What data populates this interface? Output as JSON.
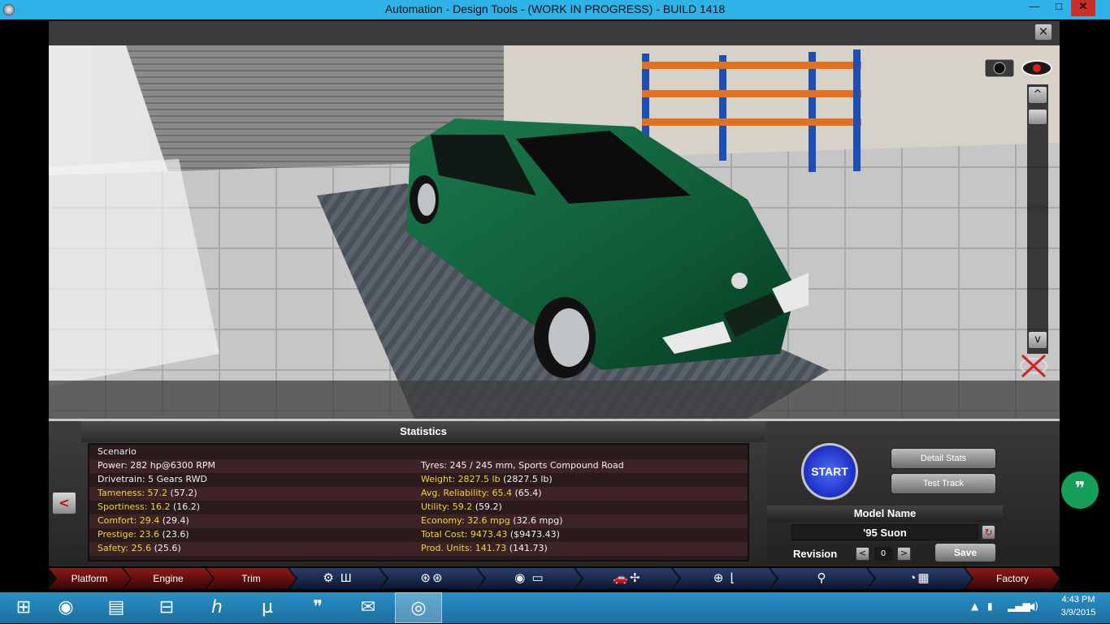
{
  "window": {
    "title": "Automation - Design Tools - (WORK IN PROGRESS) - BUILD 1418",
    "min_label": "—",
    "max_label": "□",
    "close_label": "✕"
  },
  "viewport": {
    "close_label": "✕",
    "scroll_up": "^",
    "scroll_down": "v",
    "car_color": "#0f5a37"
  },
  "statistics": {
    "header": "Statistics",
    "rows": [
      {
        "left": "Scenario",
        "right": "",
        "left_color": "white",
        "right_color": "white"
      },
      {
        "left": "Power: 282 hp@6300 RPM",
        "right": "Tyres: 245 / 245 mm, Sports Compound Road",
        "left_color": "white",
        "right_color": "white"
      },
      {
        "left": "Drivetrain: 5 Gears RWD",
        "right": "Weight: 2827.5 lb",
        "right_extra": "(2827.5 lb)",
        "left_color": "white",
        "right_color": "yellow"
      },
      {
        "left": "Tameness: 57.2",
        "left_extra": "(57.2)",
        "right": "Avg. Reliability: 65.4",
        "right_extra": "(65.4)",
        "left_color": "yellow",
        "right_color": "yellow"
      },
      {
        "left": "Sportiness: 16.2",
        "left_extra": "(16.2)",
        "right": "Utility: 59.2",
        "right_extra": "(59.2)",
        "left_color": "yellow",
        "right_color": "yellow"
      },
      {
        "left": "Comfort: 29.4",
        "left_extra": "(29.4)",
        "right": "Economy: 32.6 mpg",
        "right_extra": "(32.6 mpg)",
        "left_color": "yellow",
        "right_color": "yellow"
      },
      {
        "left": "Prestige: 23.6",
        "left_extra": "(23.6)",
        "right": "Total Cost: 9473.43",
        "right_extra": "($9473.43)",
        "left_color": "yellow",
        "right_color": "yellow"
      },
      {
        "left": "Safety: 25.6",
        "left_extra": "(25.6)",
        "right": "Prod. Units: 141.73",
        "right_extra": "(141.73)",
        "left_color": "yellow",
        "right_color": "yellow"
      }
    ]
  },
  "controls": {
    "prev_label": "<",
    "next_label": ">",
    "start_label": "START",
    "detail_stats_label": "Detail Stats",
    "test_track_label": "Test Track",
    "model_name_header": "Model Name",
    "model_name_value": "'95 Suon",
    "revision_label": "Revision",
    "revision_value": "0",
    "rev_prev": "<",
    "rev_next": ">",
    "save_label": "Save"
  },
  "tabs": [
    {
      "label": "Platform",
      "style": "red"
    },
    {
      "label": "Engine",
      "style": "red"
    },
    {
      "label": "Trim",
      "style": "red"
    },
    {
      "label": "",
      "icon": "engine-icon",
      "glyph": "⚙ Ш",
      "style": "blue"
    },
    {
      "label": "",
      "icon": "wheels-icon",
      "glyph": "⊛⊛",
      "style": "blue"
    },
    {
      "label": "",
      "icon": "body-icon",
      "glyph": "◉ ▭",
      "style": "blue"
    },
    {
      "label": "",
      "icon": "car-fan-icon",
      "glyph": "🚗✢",
      "style": "blue"
    },
    {
      "label": "",
      "icon": "steering-seat-icon",
      "glyph": "⊕ ⌊",
      "style": "blue"
    },
    {
      "label": "",
      "icon": "suspension-icon",
      "glyph": "⚲",
      "style": "blue"
    },
    {
      "label": "",
      "icon": "gauge-flag-icon",
      "glyph": "◔▦",
      "style": "blue"
    },
    {
      "label": "Factory",
      "style": "red"
    }
  ],
  "taskbar": {
    "time": "4:43 PM",
    "date": "3/9/2015"
  },
  "colors": {
    "titlebar": "#2fb2e8",
    "yellow_text": "#f1d43a",
    "start_blue": "#1d2ec6"
  }
}
